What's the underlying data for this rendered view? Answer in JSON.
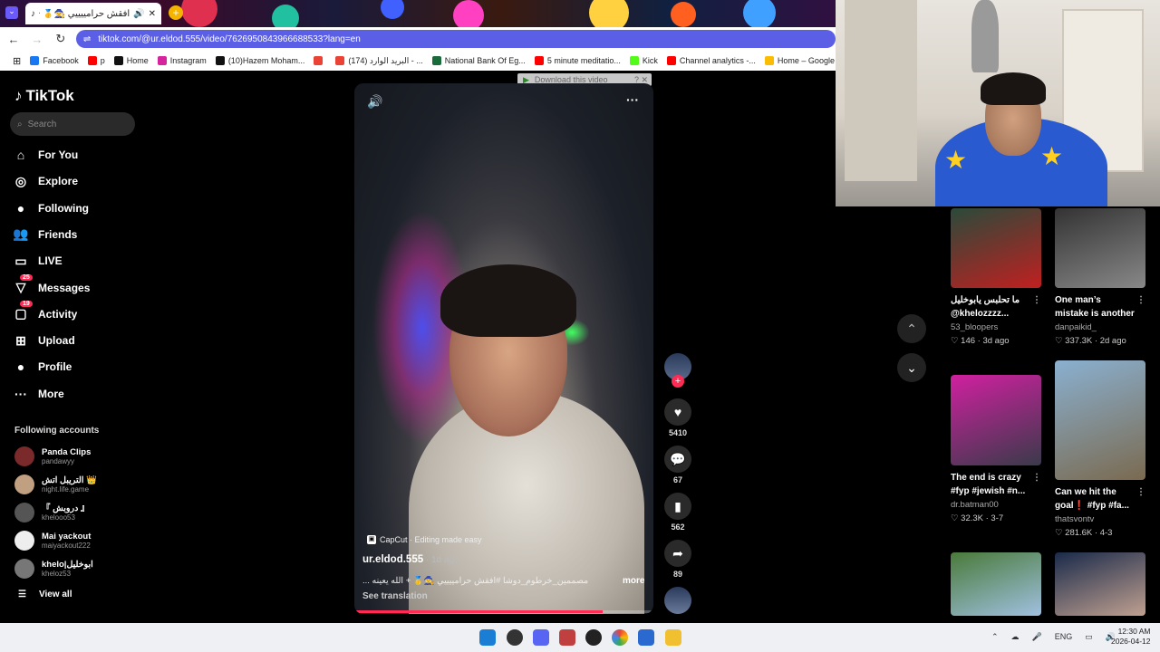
{
  "browser": {
    "tab_title": "افقش حرامييييي 🧙🥇 +",
    "url": "tiktok.com/@ur.eldod.555/video/7626950843966688533?lang=en",
    "bookmarks": [
      {
        "label": "Facebook",
        "color": "#1877f2"
      },
      {
        "label": "p",
        "color": "#ff0000"
      },
      {
        "label": "Home",
        "color": "#111111"
      },
      {
        "label": "Instagram",
        "color": "#d6249f"
      },
      {
        "label": "(10)Hazem Moham...",
        "color": "#111111"
      },
      {
        "label": "",
        "color": "#ea4335"
      },
      {
        "label": "(174) البريد الوارد - ...",
        "color": "#ea4335"
      },
      {
        "label": "National Bank Of Eg...",
        "color": "#1a6b3a"
      },
      {
        "label": "5 minute meditatio...",
        "color": "#ff0000"
      },
      {
        "label": "Kick",
        "color": "#53fc18"
      },
      {
        "label": "Channel analytics -...",
        "color": "#ff0000"
      },
      {
        "label": "Home – Google Ad...",
        "color": "#fbbc04"
      }
    ]
  },
  "sidebar": {
    "logo": "TikTok",
    "search_placeholder": "Search",
    "nav": [
      {
        "label": "For You",
        "icon": "home-icon",
        "glyph": "⌂",
        "badge": ""
      },
      {
        "label": "Explore",
        "icon": "compass-icon",
        "glyph": "◎",
        "badge": ""
      },
      {
        "label": "Following",
        "icon": "following-avatar-icon",
        "glyph": "●",
        "badge": ""
      },
      {
        "label": "Friends",
        "icon": "friends-icon",
        "glyph": "👥",
        "badge": ""
      },
      {
        "label": "LIVE",
        "icon": "live-icon",
        "glyph": "▭",
        "badge": ""
      },
      {
        "label": "Messages",
        "icon": "messages-icon",
        "glyph": "▽",
        "badge": "25"
      },
      {
        "label": "Activity",
        "icon": "activity-icon",
        "glyph": "▢",
        "badge": "19"
      },
      {
        "label": "Upload",
        "icon": "upload-icon",
        "glyph": "⊞",
        "badge": ""
      },
      {
        "label": "Profile",
        "icon": "profile-avatar-icon",
        "glyph": "●",
        "badge": ""
      },
      {
        "label": "More",
        "icon": "more-icon",
        "glyph": "···",
        "badge": ""
      }
    ],
    "following_header": "Following accounts",
    "accounts": [
      {
        "name": "Panda Clips",
        "handle": "pandawyy",
        "color": "#7a2a2a"
      },
      {
        "name": "التريبل اتش 👑",
        "handle": "night.life.game",
        "color": "#c0a080"
      },
      {
        "name": "『 دروبش 』",
        "handle": "khelooo53",
        "color": "#555555"
      },
      {
        "name": "Mai yackout",
        "handle": "maiyackout222",
        "color": "#eeeeee"
      },
      {
        "name": "khelo|ابوخليل",
        "handle": "kheloz53",
        "color": "#777777"
      }
    ],
    "view_all": "View all"
  },
  "video": {
    "download_label": "Download this video",
    "capcut_label": "CapCut · Editing made easy",
    "author": "ur.eldod.555",
    "ago": " · 1d ago",
    "description": "مصممين_خرطوم_دوشا #افقش حرامييييي 🧙🥇 + الله يعينه ...",
    "more_label": "more",
    "see_translation": "See translation",
    "progress": 0.83
  },
  "actions": {
    "likes": "5410",
    "comments": "67",
    "saves": "562",
    "shares": "89"
  },
  "recommendations": [
    {
      "title": "ما تحلبس يابوخليل @khelozzzz...",
      "user": "53_bloopers",
      "stats": "♡ 146 · 3d ago",
      "color1": "#2a4a3a",
      "color2": "#c02020"
    },
    {
      "title": "One man’s mistake is another man’s...",
      "user": "danpaikid_",
      "stats": "♡ 337.3K · 2d ago",
      "color1": "#333333",
      "color2": "#888888"
    },
    {
      "title": "The end is crazy #fyp #jewish #n...",
      "user": "dr.batman00",
      "stats": "♡ 32.3K · 3-7",
      "color1": "#d020a0",
      "color2": "#3a3a4a"
    },
    {
      "title": "Can we hit the goal❗ #fyp #fa...",
      "user": "thatsvontv",
      "stats": "♡ 281.6K · 4-3",
      "color1": "#8ab0d0",
      "color2": "#7a6a50"
    },
    {
      "title": "",
      "user": "",
      "stats": "",
      "color1": "#4a7a3a",
      "color2": "#a0c0e0"
    },
    {
      "title": "",
      "user": "",
      "stats": "",
      "color1": "#1a2a4a",
      "color2": "#c0a090"
    }
  ],
  "taskbar": {
    "lang": "ENG",
    "time": "12:30 AM",
    "date": "2026-04-12"
  }
}
